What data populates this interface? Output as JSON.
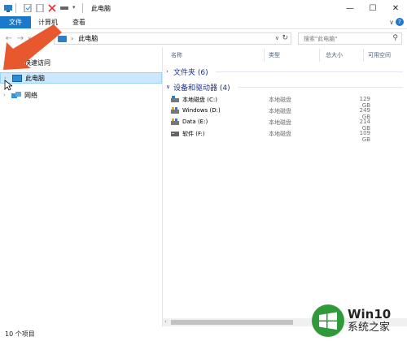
{
  "window": {
    "title": "此电脑",
    "controls": {
      "minimize": "—",
      "maximize": "☐",
      "close": "✕"
    }
  },
  "ribbon": {
    "tabs": [
      "文件",
      "计算机",
      "查看"
    ],
    "collapse": "∨",
    "help": "?"
  },
  "address": {
    "path_item": "此电脑",
    "separator": "›",
    "dropdown": "∨",
    "refresh": "↻"
  },
  "search": {
    "placeholder": "搜索\"此电脑\""
  },
  "nav": {
    "items": [
      {
        "label": "快速访问",
        "icon": "star-icon"
      },
      {
        "label": "此电脑",
        "icon": "computer-icon",
        "selected": true
      },
      {
        "label": "网络",
        "icon": "network-icon"
      }
    ]
  },
  "columns": [
    "名称",
    "类型",
    "总大小",
    "可用空间"
  ],
  "groups": [
    {
      "label": "文件夹 (6)",
      "expanded": false
    },
    {
      "label": "设备和驱动器 (4)",
      "expanded": true
    }
  ],
  "drives": [
    {
      "name": "本地磁盘 (C:)",
      "type": "本地磁盘",
      "size": "129 GB"
    },
    {
      "name": "Windows (D:)",
      "type": "本地磁盘",
      "size": "249 GB"
    },
    {
      "name": "Data (E:)",
      "type": "本地磁盘",
      "size": "214 GB"
    },
    {
      "name": "软件 (F:)",
      "type": "本地磁盘",
      "size": "109 GB"
    }
  ],
  "status": {
    "count": "10 个项目"
  },
  "watermark": {
    "line1": "Win10",
    "line2": "系统之家"
  },
  "colors": {
    "accent": "#1979ca",
    "selection": "#cce8ff",
    "arrow": "#e8582e",
    "group_text": "#1e3287"
  }
}
